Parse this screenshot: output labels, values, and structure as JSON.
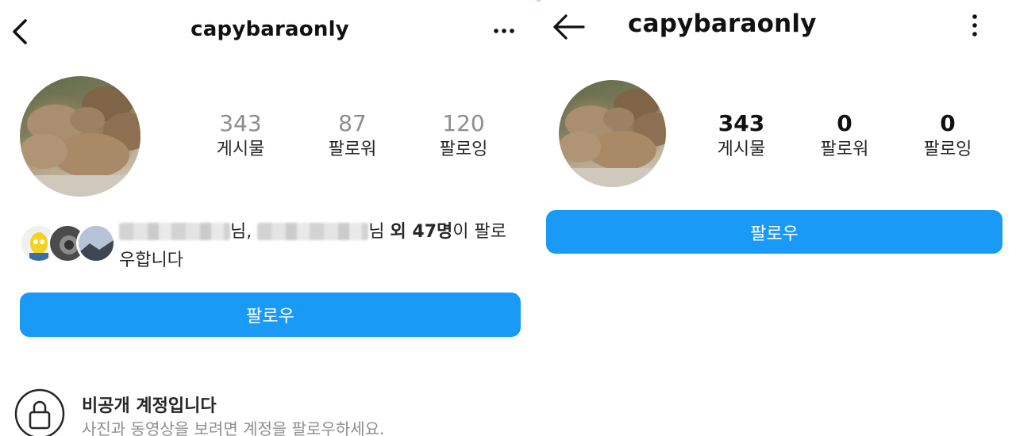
{
  "left": {
    "header": {
      "username": "capybaraonly",
      "back_icon": "chevron-left-icon",
      "more_icon": "more-horizontal-icon"
    },
    "stats": [
      {
        "value": "343",
        "label": "게시물"
      },
      {
        "value": "87",
        "label": "팔로워"
      },
      {
        "value": "120",
        "label": "팔로잉"
      }
    ],
    "followed_by": {
      "name1_suffix": "님,",
      "name2_suffix": "님",
      "others": "외 47명",
      "tail": "이 팔로",
      "line2": "우합니다"
    },
    "follow_button": "팔로우",
    "private": {
      "title": "비공개 계정입니다",
      "subtitle": "사진과 동영상을 보려면 계정을 팔로우하세요."
    }
  },
  "right": {
    "header": {
      "username": "capybaraonly",
      "back_icon": "arrow-left-icon",
      "more_icon": "more-vertical-icon"
    },
    "stats": [
      {
        "value": "343",
        "label": "게시물"
      },
      {
        "value": "0",
        "label": "팔로워"
      },
      {
        "value": "0",
        "label": "팔로잉"
      }
    ],
    "follow_button": "팔로우"
  },
  "colors": {
    "accent": "#1a9af7",
    "muted_text": "#8e8e8e",
    "text": "#262626"
  }
}
